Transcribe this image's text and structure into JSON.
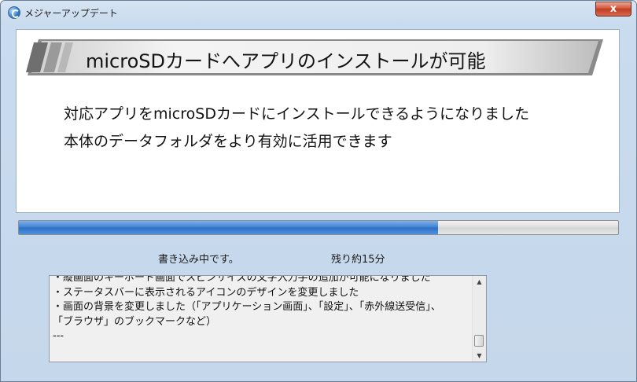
{
  "window": {
    "title": "メジャーアップデート",
    "close_label": "x"
  },
  "banner": {
    "heading": "microSDカードへアプリのインストールが可能"
  },
  "description": [
    "対応アプリをmicroSDカードにインストールできるようになりました",
    "本体のデータフォルダをより有効に活用できます"
  ],
  "progress": {
    "fraction": 0.7
  },
  "status": {
    "writing": "書き込み中です。",
    "remaining": "残り約15分"
  },
  "log": {
    "lines": [
      "・縦画面のキーボード画面でスピンサイズの文字入力手の追加が可能になりました",
      "・ステータスバーに表示されるアイコンのデザインを変更しました",
      "・画面の背景を変更しました（「アプリケーション画面」、「設定」、「赤外線送受信」、",
      "「ブラウザ」のブックマークなど）",
      "---"
    ]
  },
  "colors": {
    "progress_fill": "#3d7fd2",
    "close_button": "#c23c22"
  },
  "icons": {
    "app": "update-globe-icon",
    "close": "close-icon",
    "scroll_up": "scroll-up-arrow-icon",
    "scroll_down": "scroll-down-arrow-icon"
  }
}
